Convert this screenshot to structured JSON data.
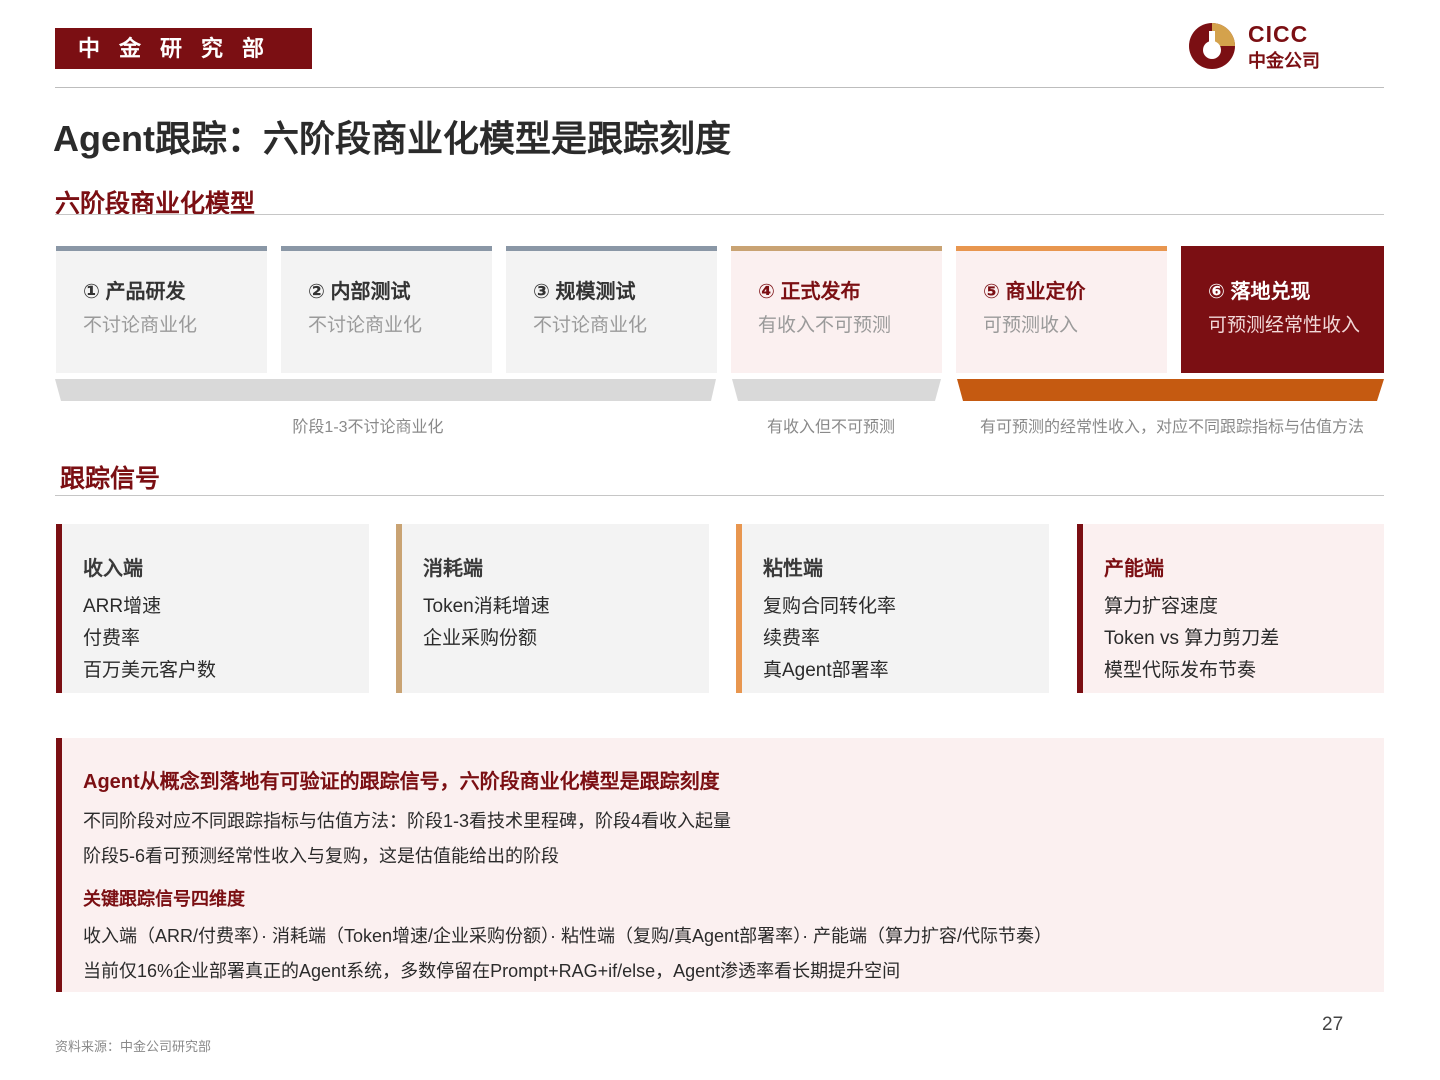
{
  "header": {
    "department": "中金研究部",
    "logo_en": "CICC",
    "logo_cn": "中金公司"
  },
  "title": "Agent跟踪：六阶段商业化模型是跟踪刻度",
  "section1": {
    "title": "六阶段商业化模型",
    "stages": [
      {
        "name": "① 产品研发",
        "desc": "不讨论商业化"
      },
      {
        "name": "② 内部测试",
        "desc": "不讨论商业化"
      },
      {
        "name": "③ 规模测试",
        "desc": "不讨论商业化"
      },
      {
        "name": "④ 正式发布",
        "desc": "有收入不可预测"
      },
      {
        "name": "⑤ 商业定价",
        "desc": "可预测收入"
      },
      {
        "name": "⑥ 落地兑现",
        "desc": "可预测经常性收入"
      }
    ],
    "bands": [
      {
        "label": "阶段1-3不讨论商业化"
      },
      {
        "label": "有收入但不可预测"
      },
      {
        "label": "有可预测的经常性收入，对应不同跟踪指标与估值方法"
      }
    ]
  },
  "section2": {
    "title": "跟踪信号",
    "signals": [
      {
        "title": "收入端",
        "items": [
          "ARR增速",
          "付费率",
          "百万美元客户数"
        ]
      },
      {
        "title": "消耗端",
        "items": [
          "Token消耗增速",
          "企业采购份额"
        ]
      },
      {
        "title": "粘性端",
        "items": [
          "复购合同转化率",
          "续费率",
          "真Agent部署率"
        ]
      },
      {
        "title": "产能端",
        "items": [
          "算力扩容速度",
          "Token vs 算力剪刀差",
          "模型代际发布节奏"
        ]
      }
    ]
  },
  "summary": {
    "heading": "Agent从概念到落地有可验证的跟踪信号，六阶段商业化模型是跟踪刻度",
    "line1": "不同阶段对应不同跟踪指标与估值方法：阶段1-3看技术里程碑，阶段4看收入起量",
    "line2": "阶段5-6看可预测经常性收入与复购，这是估值能给出的阶段",
    "subheading": "关键跟踪信号四维度",
    "line3": "收入端（ARR/付费率）· 消耗端（Token增速/企业采购份额）· 粘性端（复购/真Agent部署率）· 产能端（算力扩容/代际节奏）",
    "line4": "当前仅16%企业部署真正的Agent系统，多数停留在Prompt+RAG+if/else，Agent渗透率看长期提升空间"
  },
  "footer": {
    "page_number": "27",
    "source": "资料来源：中金公司研究部"
  },
  "colors": {
    "brand": "#7b0f13",
    "stage_bar_gray": "#8a97a6",
    "stage_bar_tan": "#c9a373",
    "stage_bar_orange": "#e8964f",
    "band_gray": "#d9d9d9",
    "band_orange": "#c55a11",
    "signal_tan": "#c9a373",
    "signal_orange": "#e8964f"
  }
}
